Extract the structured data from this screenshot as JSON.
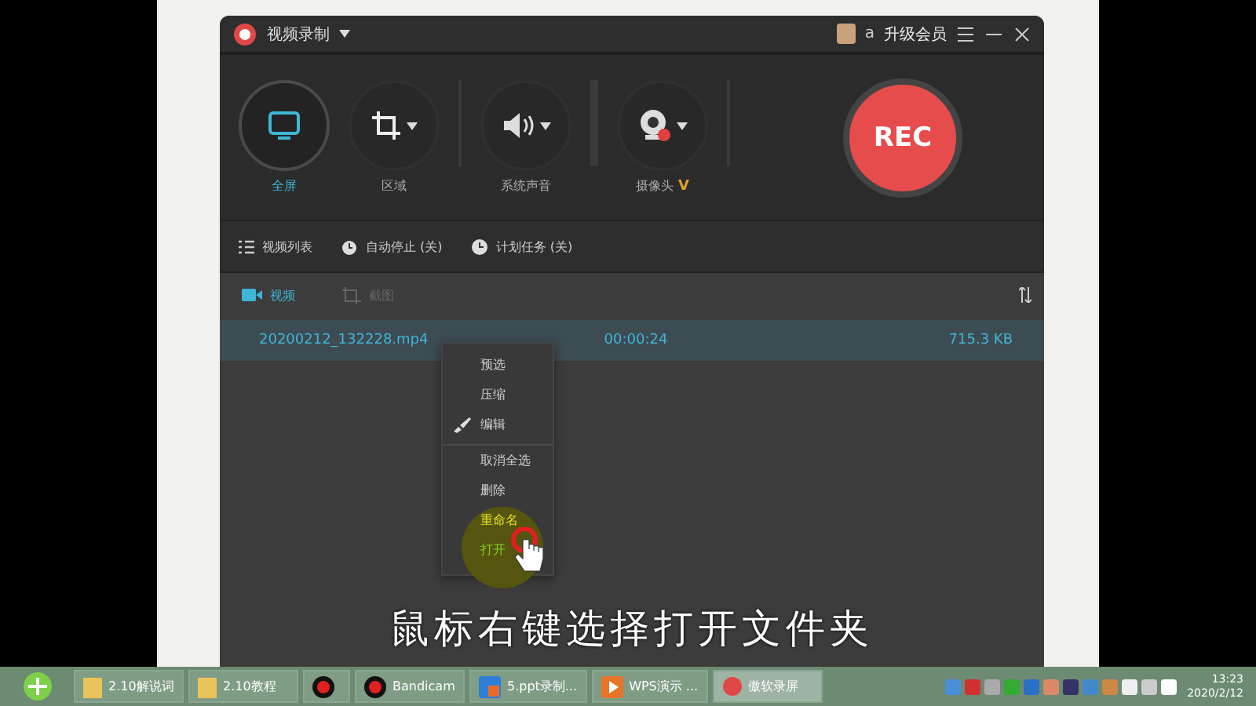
{
  "window": {
    "title": "视频录制",
    "account": "a",
    "upgrade": "升级会员"
  },
  "tools": [
    {
      "label": "全屏",
      "kind": "screen",
      "selected": true
    },
    {
      "label": "区域",
      "kind": "crop",
      "selected": false
    },
    {
      "label": "系统声音",
      "kind": "audio",
      "selected": false
    },
    {
      "label": "摄像头",
      "kind": "camera",
      "selected": false,
      "badge": "V"
    }
  ],
  "rec_button": "REC",
  "options": [
    {
      "label": "视频列表",
      "kind": "list"
    },
    {
      "label": "自动停止 (关)",
      "kind": "alarm"
    },
    {
      "label": "计划任务 (关)",
      "kind": "clock"
    }
  ],
  "media_tabs": [
    {
      "label": "视频",
      "kind": "video",
      "selected": true
    },
    {
      "label": "截图",
      "kind": "shot",
      "selected": false
    }
  ],
  "files": [
    {
      "name": "20200212_132228.mp4",
      "duration": "00:00:24",
      "size": "715.3 KB",
      "selected": true
    }
  ],
  "context_menu": [
    {
      "label": "预选",
      "kind": "plain",
      "color": "#d0d0d0"
    },
    {
      "label": "压缩",
      "kind": "plain",
      "color": "#d0d0d0"
    },
    {
      "label": "编辑",
      "kind": "brush",
      "color": "#d0d0d0"
    },
    {
      "label": "取消全选",
      "kind": "divided",
      "color": "#d0d0d0"
    },
    {
      "label": "删除",
      "kind": "plain",
      "color": "#d0d0d0"
    },
    {
      "label": "重命名",
      "kind": "plain",
      "color": "#e8e020"
    },
    {
      "label": "打开",
      "kind": "cursor",
      "color": "#7fd020"
    }
  ],
  "subtitle": "鼠标右键选择打开文件夹",
  "taskbar": {
    "items": [
      {
        "label": "2.10解说词",
        "kind": "folder",
        "active": false
      },
      {
        "label": "2.10教程",
        "kind": "folder",
        "active": false
      },
      {
        "kind": "record",
        "active": false
      },
      {
        "label": "Bandicam",
        "kind": "record",
        "active": false
      },
      {
        "label": "5.ppt录制...",
        "kind": "ppt",
        "active": false
      },
      {
        "label": "WPS演示 ...",
        "kind": "wps",
        "active": false
      },
      {
        "label": "傲软录屏",
        "kind": "rec",
        "active": true
      }
    ],
    "time": "13:23",
    "date": "2020/2/12"
  }
}
